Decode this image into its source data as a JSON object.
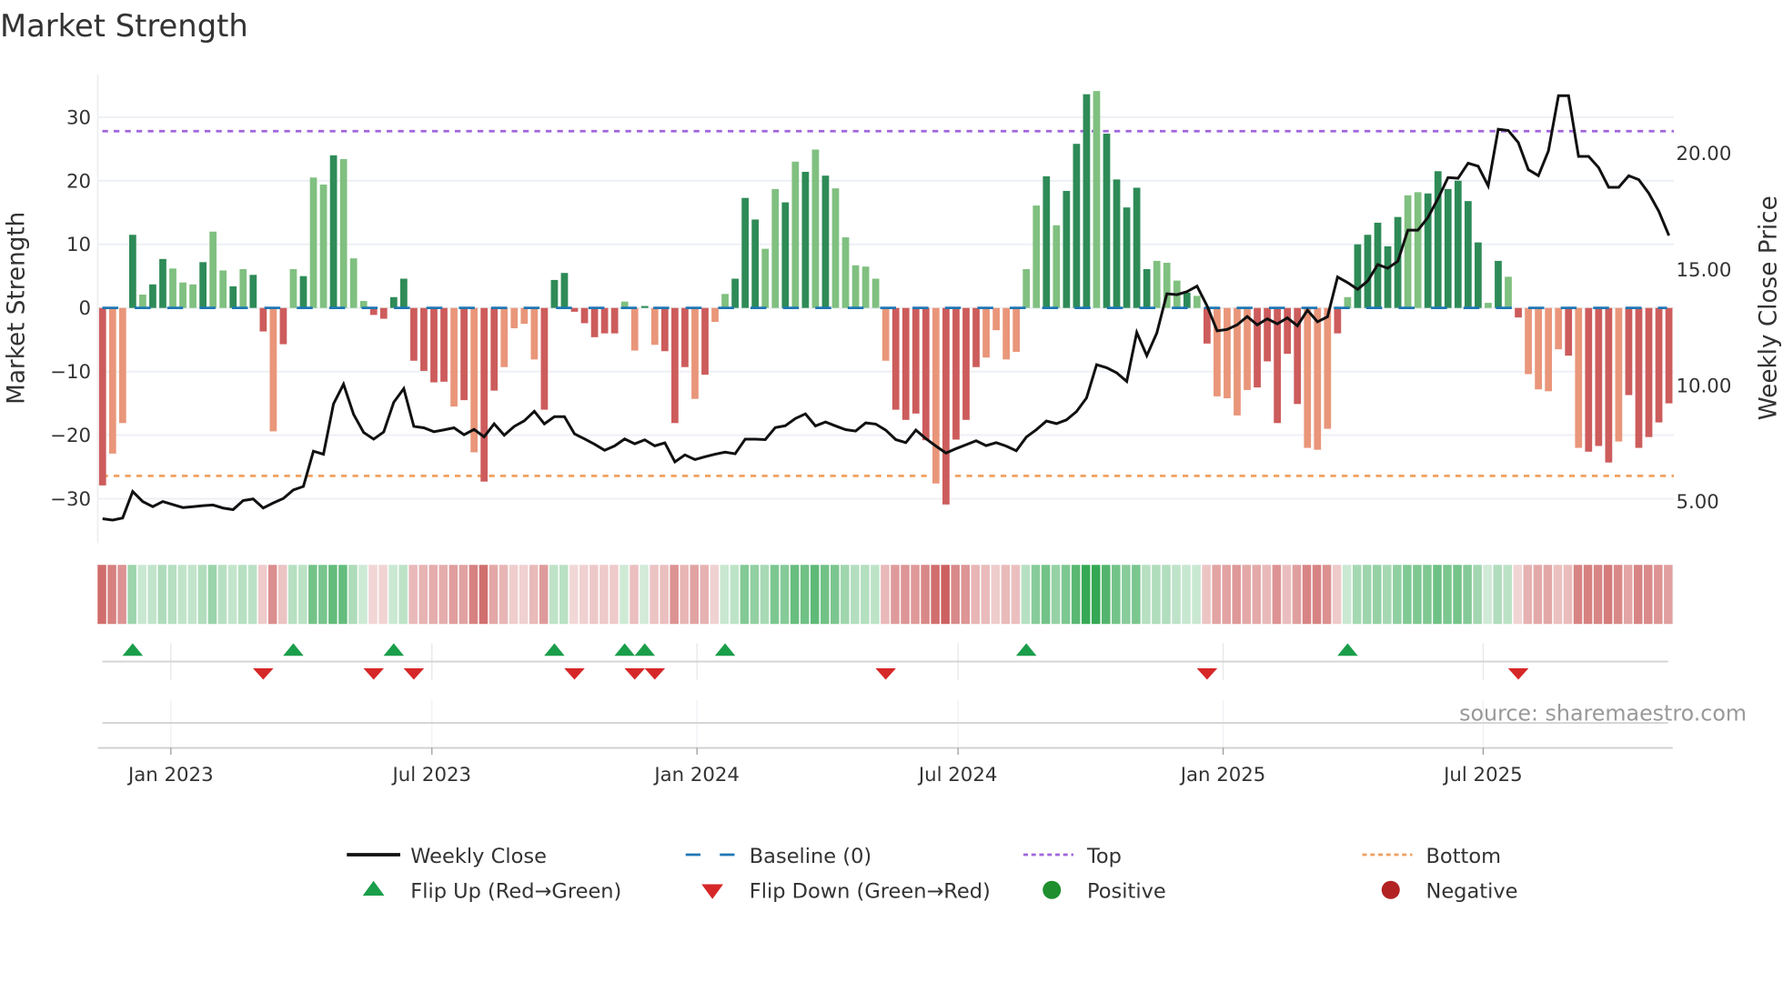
{
  "title": "Market Strength",
  "source": "source: sharemaestro.com",
  "colors": {
    "pos_strong": "#2e8b57",
    "pos_weak": "#80c080",
    "neg_strong": "#cd5c5c",
    "neg_weak": "#e9967a",
    "baseline": "#1f77b4",
    "top": "#a066dd",
    "bottom": "#f0a060",
    "close": "#111111",
    "flip_up": "#1a9e4a",
    "flip_down": "#d62728",
    "positive": "#1e8e2e",
    "negative": "#b22222"
  },
  "legend": [
    {
      "key": "close",
      "label": "Weekly Close"
    },
    {
      "key": "baseline",
      "label": "Baseline (0)"
    },
    {
      "key": "top",
      "label": "Top"
    },
    {
      "key": "bottom",
      "label": "Bottom"
    },
    {
      "key": "flip_up",
      "label": "Flip Up (Red→Green)"
    },
    {
      "key": "flip_down",
      "label": "Flip Down (Green→Red)"
    },
    {
      "key": "positive",
      "label": "Positive"
    },
    {
      "key": "negative",
      "label": "Negative"
    }
  ],
  "chart_data": {
    "type": "bar",
    "title": "Market Strength",
    "ylabel": "Market Strength",
    "y2label": "Weekly Close Price",
    "ylim": [
      -37,
      36.8
    ],
    "y2lim": [
      3.19,
      23.43
    ],
    "yticks": [
      30,
      20,
      10,
      0,
      -10,
      -20,
      -30
    ],
    "ytick_labels": [
      "30",
      "20",
      "10",
      "0",
      "−10",
      "−20",
      "−30"
    ],
    "y2ticks": [
      20,
      15,
      10,
      5
    ],
    "y2tick_labels": [
      "20.00",
      "15.00",
      "10.00",
      "5.00"
    ],
    "x_unit": "week index",
    "xticks": [
      6.8,
      32.8,
      59.2,
      85.2,
      111.6,
      137.5
    ],
    "xtick_labels": [
      "Jan 2023",
      "Jul 2023",
      "Jan 2024",
      "Jul 2024",
      "Jan 2025",
      "Jul 2025"
    ],
    "top_level": 27.8,
    "bottom_level": -26.4,
    "baseline": 0,
    "grid": true,
    "legend_position": "bottom",
    "series": [
      {
        "name": "Market Strength",
        "type": "bar",
        "values": [
          -27.9,
          -22.9,
          -18.1,
          11.5,
          2.1,
          3.7,
          7.7,
          6.2,
          4.0,
          3.7,
          7.2,
          12.0,
          5.9,
          3.4,
          6.1,
          5.2,
          -3.7,
          -19.4,
          -5.7,
          6.1,
          5.0,
          20.5,
          19.4,
          24.0,
          23.4,
          7.8,
          1.1,
          -1.1,
          -1.7,
          1.7,
          4.6,
          -8.3,
          -9.9,
          -11.7,
          -11.6,
          -15.5,
          -14.5,
          -22.7,
          -27.3,
          -13.0,
          -9.3,
          -3.2,
          -2.5,
          -8.1,
          -16.0,
          4.4,
          5.5,
          -0.6,
          -2.4,
          -4.6,
          -4.0,
          -4.0,
          1.0,
          -6.7,
          0.3,
          -5.8,
          -6.8,
          -18.1,
          -9.3,
          -14.3,
          -10.5,
          -2.2,
          2.2,
          4.6,
          17.3,
          13.9,
          9.3,
          18.7,
          16.6,
          23.0,
          21.4,
          24.9,
          20.8,
          18.8,
          11.1,
          6.7,
          6.5,
          4.6,
          -8.3,
          -16.0,
          -17.6,
          -16.6,
          -20.8,
          -27.6,
          -30.9,
          -20.7,
          -17.6,
          -9.3,
          -7.8,
          -3.5,
          -8.1,
          -6.9,
          6.1,
          16.1,
          20.7,
          13.0,
          18.4,
          25.8,
          33.6,
          34.1,
          27.4,
          20.2,
          15.8,
          18.9,
          6.1,
          7.4,
          7.1,
          4.3,
          2.4,
          1.9,
          -5.6,
          -13.9,
          -14.2,
          -16.9,
          -12.9,
          -12.5,
          -8.4,
          -18.1,
          -7.2,
          -15.1,
          -22.0,
          -22.3,
          -19.0,
          -4.0,
          1.7,
          10.0,
          11.5,
          13.4,
          9.7,
          14.3,
          17.7,
          18.2,
          18.0,
          21.5,
          18.7,
          20.0,
          16.8,
          10.3,
          0.8,
          7.4,
          4.9,
          -1.5,
          -10.4,
          -12.8,
          -13.1,
          -6.5,
          -7.5,
          -22.0,
          -22.6,
          -21.7,
          -24.3,
          -21.0,
          -13.7,
          -22.0,
          -20.3,
          -18.0,
          -15.0
        ],
        "shade": "dlldlddllldlldlddldldlldlllddddddddldlddllllddddddddlldldddldlldddlldldldllllllddddlddddlllllldldddldddddllldldlllldddddllldldddddllddddddldldlllldldddldddddldllldll"
      },
      {
        "name": "Weekly Close",
        "type": "line",
        "axis": "right",
        "values": [
          4.25,
          4.19,
          4.28,
          5.42,
          4.99,
          4.77,
          4.99,
          4.86,
          4.73,
          4.77,
          4.81,
          4.84,
          4.71,
          4.64,
          5.03,
          5.1,
          4.71,
          4.93,
          5.12,
          5.49,
          5.64,
          7.16,
          7.03,
          9.2,
          10.05,
          8.75,
          7.97,
          7.68,
          7.99,
          9.27,
          9.86,
          8.23,
          8.17,
          8.0,
          8.08,
          8.17,
          7.87,
          8.1,
          7.78,
          8.34,
          7.85,
          8.23,
          8.47,
          8.88,
          8.34,
          8.65,
          8.65,
          7.91,
          7.69,
          7.46,
          7.2,
          7.39,
          7.69,
          7.48,
          7.65,
          7.39,
          7.52,
          6.7,
          7.0,
          6.8,
          6.92,
          7.03,
          7.12,
          7.05,
          7.68,
          7.68,
          7.66,
          8.18,
          8.26,
          8.57,
          8.77,
          8.25,
          8.42,
          8.25,
          8.09,
          8.03,
          8.38,
          8.33,
          8.07,
          7.66,
          7.53,
          8.07,
          7.7,
          7.38,
          7.08,
          7.27,
          7.44,
          7.61,
          7.4,
          7.53,
          7.38,
          7.18,
          7.77,
          8.09,
          8.46,
          8.35,
          8.51,
          8.87,
          9.46,
          10.89,
          10.76,
          10.54,
          10.17,
          12.28,
          11.28,
          12.26,
          13.95,
          13.91,
          14.04,
          14.28,
          13.43,
          12.35,
          12.41,
          12.61,
          12.97,
          12.61,
          12.87,
          12.65,
          12.91,
          12.57,
          13.24,
          12.74,
          12.96,
          14.67,
          14.43,
          14.14,
          14.5,
          15.21,
          15.05,
          15.35,
          16.69,
          16.69,
          17.24,
          18.05,
          18.96,
          18.93,
          19.58,
          19.45,
          18.6,
          21.04,
          20.99,
          20.47,
          19.3,
          19.04,
          20.11,
          22.49,
          22.49,
          19.87,
          19.87,
          19.39,
          18.54,
          18.54,
          19.04,
          18.87,
          18.28,
          17.5,
          16.46
        ]
      }
    ]
  }
}
